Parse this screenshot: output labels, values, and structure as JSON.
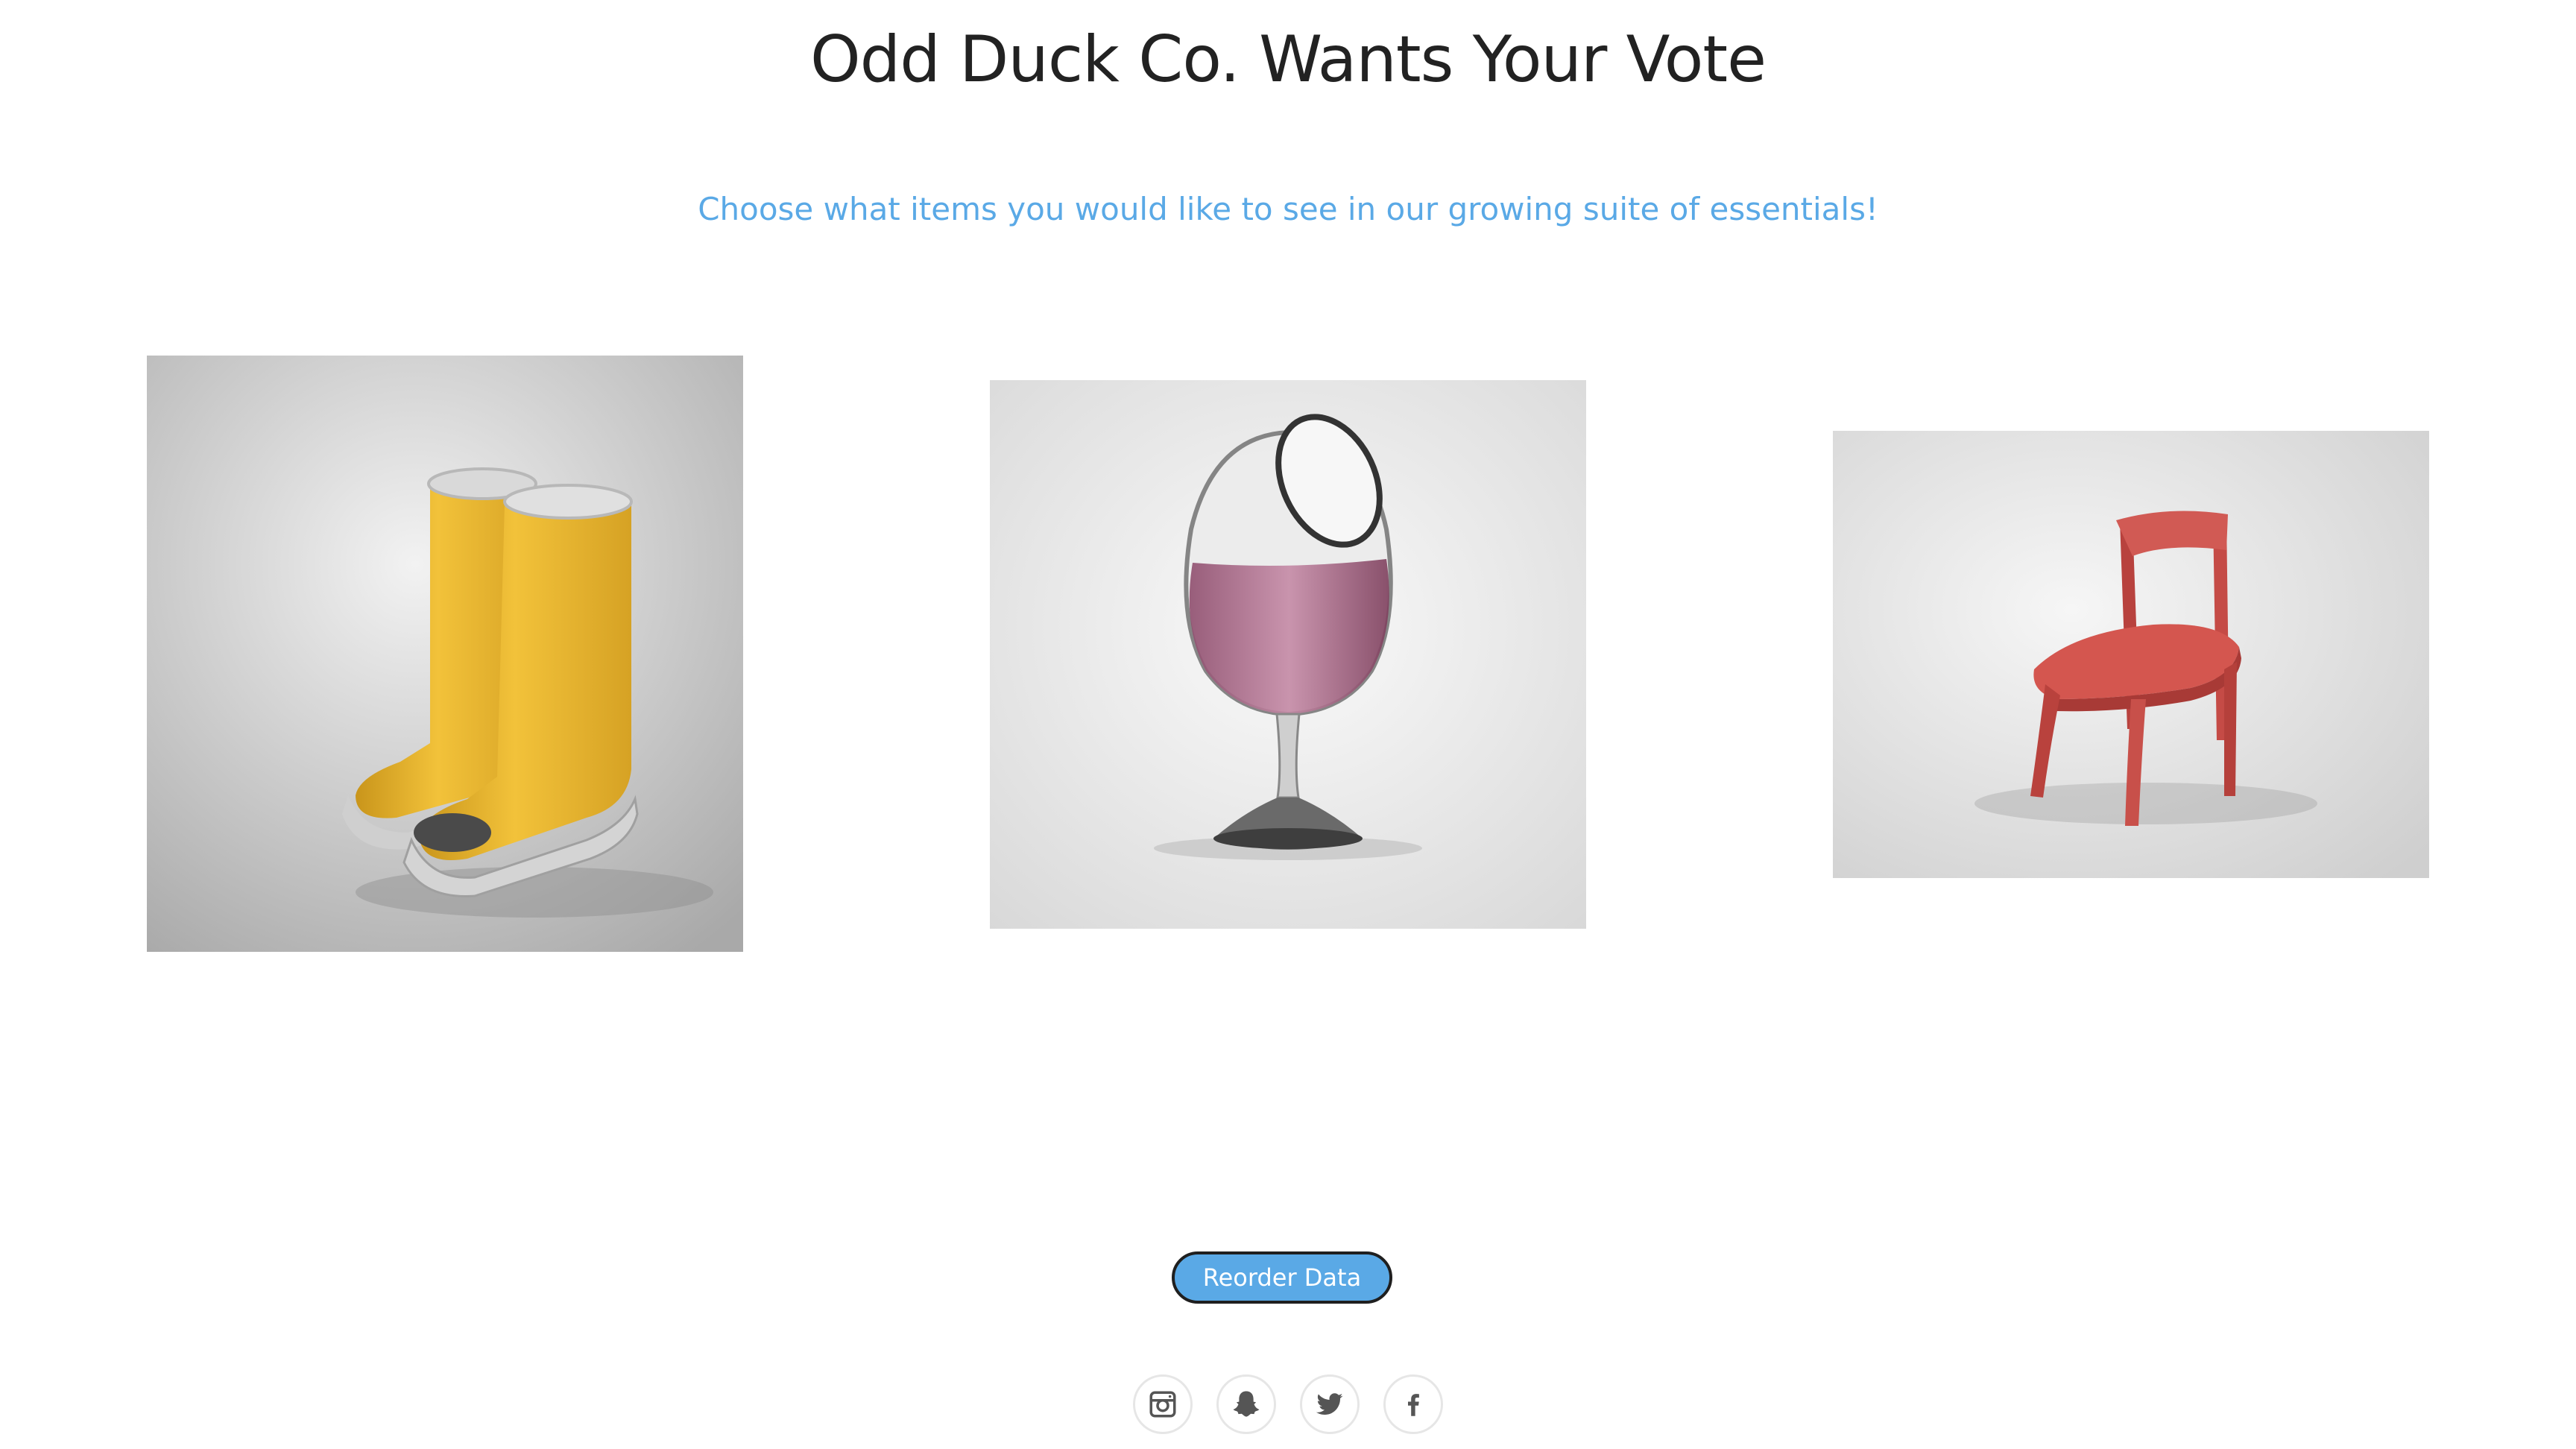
{
  "header": {
    "title": "Odd Duck Co. Wants Your Vote",
    "subtitle": "Choose what items you would like to see in our growing suite of essentials!"
  },
  "products": [
    {
      "name": "boots",
      "description": "yellow open-toe rain boots"
    },
    {
      "name": "wine-glass",
      "description": "wine glass with opening on the side"
    },
    {
      "name": "chair",
      "description": "red chair with curved seat"
    }
  ],
  "controls": {
    "reorder_label": "Reorder Data"
  },
  "footer": {
    "social": [
      {
        "name": "instagram-icon"
      },
      {
        "name": "snapchat-icon"
      },
      {
        "name": "twitter-icon"
      },
      {
        "name": "facebook-icon"
      }
    ]
  },
  "colors": {
    "accent": "#5aa9e6",
    "title": "#222222",
    "icon": "#555555"
  }
}
